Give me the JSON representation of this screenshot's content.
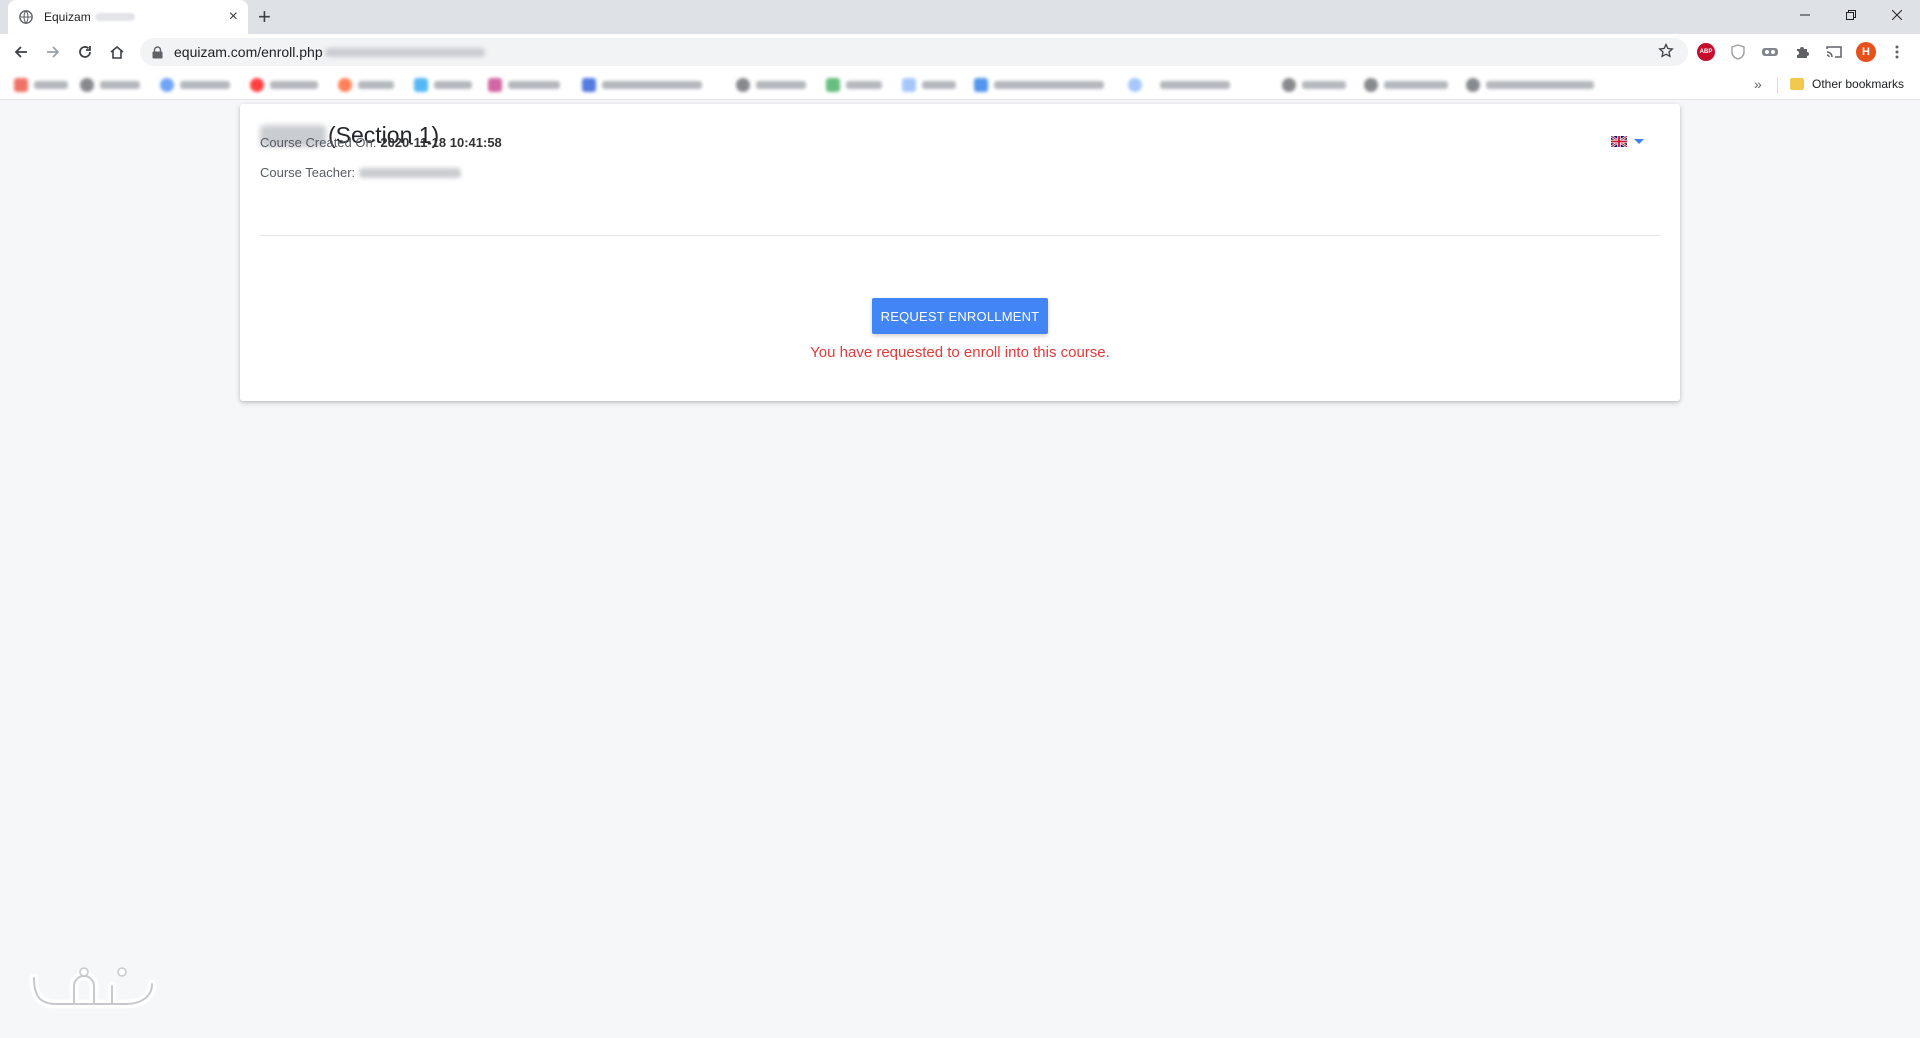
{
  "browser": {
    "tab_title": "Equizam",
    "tab_close": "×",
    "new_tab": "+",
    "url": "equizam.com/enroll.php",
    "profile_initial": "H",
    "abp_label": "ABP",
    "bookmarks_overflow": "»",
    "other_bookmarks": "Other bookmarks"
  },
  "course": {
    "title_suffix": "(Section 1)",
    "created_label": "Course Created On:",
    "created_value": "2020-11-18 10:41:58",
    "teacher_label": "Course Teacher:"
  },
  "enrollment": {
    "button_label": "REQUEST ENROLLMENT",
    "status_message": "You have requested to enroll into this course."
  },
  "language": {
    "selected": "English (UK)"
  },
  "colors": {
    "primary": "#4285f4",
    "error": "#e53935",
    "background": "#f5f7f9"
  }
}
